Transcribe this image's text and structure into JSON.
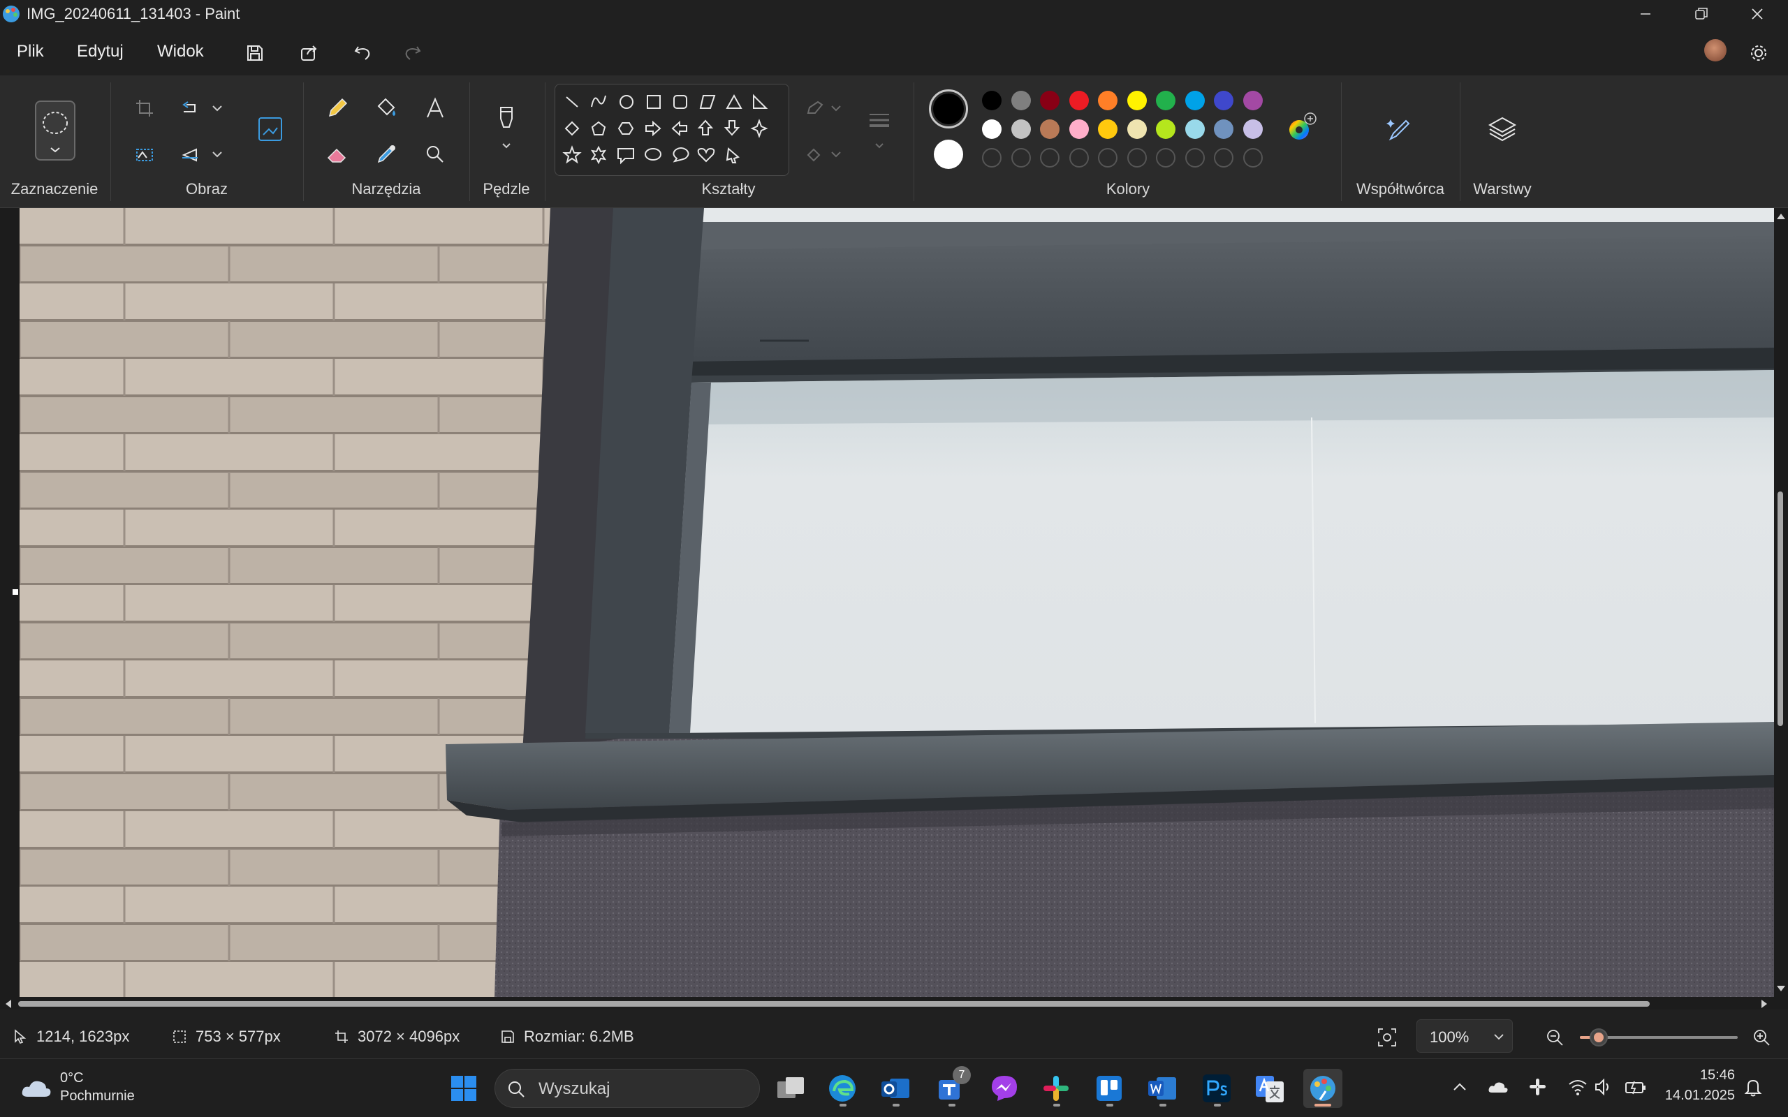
{
  "window": {
    "title": "IMG_20240611_131403 - Paint"
  },
  "menu": {
    "file": "Plik",
    "edit": "Edytuj",
    "view": "Widok"
  },
  "ribbon": {
    "groups": {
      "selection": "Zaznaczenie",
      "image": "Obraz",
      "tools": "Narzędzia",
      "brushes": "Pędzle",
      "shapes": "Kształty",
      "colors": "Kolory",
      "cocreator": "Współtwórca",
      "layers": "Warstwy"
    },
    "active_colors": {
      "primary": "#000000",
      "secondary": "#ffffff"
    },
    "palette_row1": [
      "#000000",
      "#7f7f7f",
      "#880015",
      "#ed1c24",
      "#ff7f27",
      "#fff200",
      "#22b14c",
      "#00a2e8",
      "#3f48cc",
      "#a349a4"
    ],
    "palette_row2": [
      "#ffffff",
      "#c3c3c3",
      "#b97a57",
      "#ffaec9",
      "#ffc90e",
      "#efe4b0",
      "#b5e61d",
      "#99d9ea",
      "#7092be",
      "#c8bfe7"
    ],
    "custom_slots": 10
  },
  "status": {
    "cursor_position": "1214, 1623px",
    "selection_size": "753 × 577px",
    "image_size": "3072 × 4096px",
    "file_size": "Rozmiar: 6.2MB",
    "zoom": "100%",
    "zoom_slider_fraction": 0.12
  },
  "taskbar": {
    "weather_temp": "0°C",
    "weather_desc": "Pochmurnie",
    "search_placeholder": "Wyszukaj",
    "teams_badge": "7",
    "time": "15:46",
    "date": "14.01.2025"
  }
}
